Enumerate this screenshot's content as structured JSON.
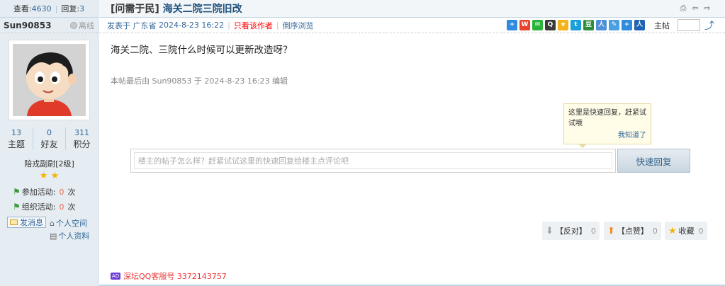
{
  "stats": {
    "views_label": "查看:",
    "views": "4630",
    "replies_label": "回复:",
    "replies": "3"
  },
  "user": {
    "name": "Sun90853",
    "status": "离线",
    "counters": [
      {
        "value": "13",
        "label": "主题"
      },
      {
        "value": "0",
        "label": "好友"
      },
      {
        "value": "311",
        "label": "积分"
      }
    ],
    "rank": "陪戎副尉[2级]",
    "activities": [
      {
        "label": "参加活动:",
        "value": "0",
        "unit": "次"
      },
      {
        "label": "组织活动:",
        "value": "0",
        "unit": "次"
      }
    ],
    "send_message": "发消息",
    "space": "个人空间",
    "profile": "个人资料"
  },
  "thread": {
    "category": "[问需于民]",
    "title": "海关二院三院旧改",
    "posted_label": "发表于",
    "location": "广东省",
    "date": "2024-8-23 16:22",
    "only_author": "只看该作者",
    "reverse": "倒序浏览",
    "floor_label": "主帖"
  },
  "post": {
    "content": "海关二院、三院什么时候可以更新改造呀？",
    "edit_note": "本帖最后由 Sun90853 于 2024-8-23 16:23 编辑"
  },
  "tip": {
    "text": "这里是快速回复，赶紧试试哦",
    "ok": "我知道了"
  },
  "reply": {
    "placeholder": "楼主的帖子怎么样？赶紧试试这里的快速回复给楼主点评论吧",
    "button": "快速回复"
  },
  "votes": [
    {
      "label": "【反对】",
      "count": "0"
    },
    {
      "label": "【点赞】",
      "count": "0"
    },
    {
      "label": "收藏",
      "count": "0"
    }
  ],
  "ad": {
    "badge": "AD",
    "text": "深坛QQ客服号 3372143757"
  }
}
